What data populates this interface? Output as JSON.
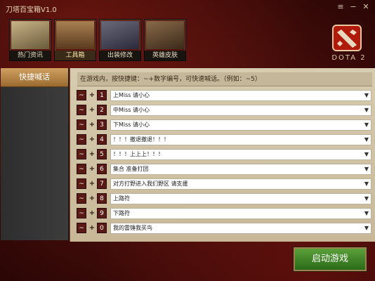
{
  "window": {
    "title": "刀塔百宝箱V1.0"
  },
  "nav": {
    "items": [
      {
        "label": "热门资讯"
      },
      {
        "label": "工具箱"
      },
      {
        "label": "出装修改"
      },
      {
        "label": "英雄皮肤"
      }
    ]
  },
  "brand": {
    "logo_text": "DOTA 2"
  },
  "sidebar": {
    "items": [
      {
        "label": "快捷喊话"
      }
    ]
  },
  "main": {
    "hint": "在游戏内，按快捷键：~+数字编号，可快速喊话。（例如：~5）",
    "rows": [
      {
        "key1": "~",
        "key2": "1",
        "text": "上Miss 请小心"
      },
      {
        "key1": "~",
        "key2": "2",
        "text": "中Miss 请小心"
      },
      {
        "key1": "~",
        "key2": "3",
        "text": "下Miss 请小心"
      },
      {
        "key1": "~",
        "key2": "4",
        "text": "！！！撤退撤退！！！"
      },
      {
        "key1": "~",
        "key2": "5",
        "text": "！！！上上上！！！"
      },
      {
        "key1": "~",
        "key2": "6",
        "text": "集合 准备打团"
      },
      {
        "key1": "~",
        "key2": "7",
        "text": "对方打野进入我们野区 请支援"
      },
      {
        "key1": "~",
        "key2": "8",
        "text": "上路符"
      },
      {
        "key1": "~",
        "key2": "9",
        "text": "下路符"
      },
      {
        "key1": "~",
        "key2": "0",
        "text": "我的雷锤我买鸟"
      }
    ]
  },
  "footer": {
    "start_label": "启动游戏"
  },
  "colors": {
    "accent": "#5a1a14",
    "start": "#3a8a24",
    "sidebar_active": "#c08a48"
  }
}
